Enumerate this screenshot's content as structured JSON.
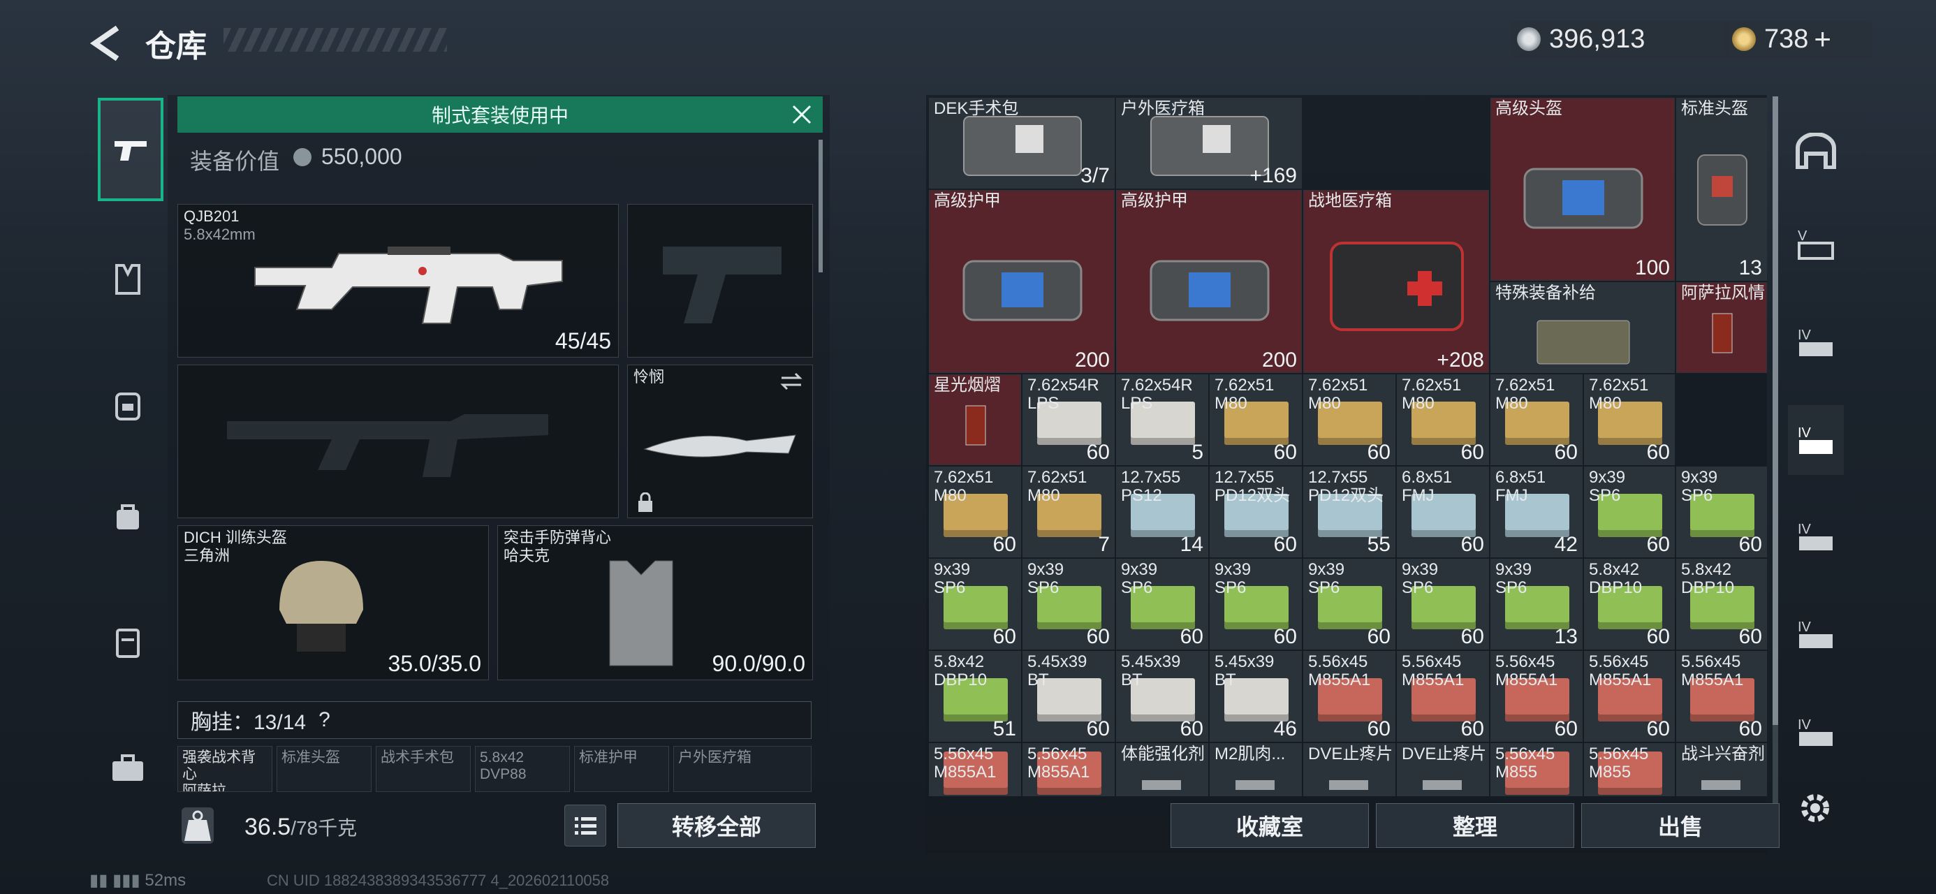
{
  "header": {
    "title": "仓库",
    "currency_silver": "396,913",
    "currency_gold": "738",
    "add_symbol": "+"
  },
  "loadout": {
    "banner": "制式套装使用中",
    "equip_value_label": "装备价值",
    "equip_value": "550,000",
    "primary": {
      "name": "QJB201",
      "caliber": "5.8x42mm",
      "ammo": "45/45"
    },
    "melee": {
      "name": "怜悯"
    },
    "helmet": {
      "name": "DICH 训练头盔",
      "map": "三角洲",
      "durability": "35.0/35.0"
    },
    "armor": {
      "name": "突击手防弹背心",
      "map": "哈夫克",
      "durability": "90.0/90.0"
    },
    "chest_label": "胸挂：13/14",
    "chest_help": "?",
    "chest_sub": [
      {
        "l1": "强袭战术背心",
        "l2": "阿萨拉"
      },
      {
        "l1": "标准头盔",
        "l2": ""
      },
      {
        "l1": "战术手术包",
        "l2": ""
      },
      {
        "l1": "5.8x42",
        "l2": "DVP88"
      },
      {
        "l1": "标准护甲",
        "l2": ""
      },
      {
        "l1": "户外医疗箱",
        "l2": ""
      }
    ],
    "weight": "36.5",
    "weight_max": "/78千克",
    "transfer_all": "转移全部"
  },
  "storage": {
    "items": [
      {
        "n": "DEK手术包",
        "c": "3/7"
      },
      {
        "n": "户外医疗箱",
        "c": "+169"
      },
      {
        "n": "高级头盔",
        "c": "100"
      },
      {
        "n": "标准头盔",
        "c": "13"
      },
      {
        "n": "高级护甲",
        "c": "200"
      },
      {
        "n": "高级护甲",
        "c": "200"
      },
      {
        "n": "战地医疗箱",
        "c": "+208"
      },
      {
        "n": "特殊装备补给",
        "c": ""
      },
      {
        "n": "阿萨拉风情",
        "c": ""
      },
      {
        "n": "星光烟熠",
        "c": ""
      },
      {
        "n": "7.62x54R\nLPS",
        "c": "60"
      },
      {
        "n": "7.62x54R\nLPS",
        "c": "5"
      },
      {
        "n": "7.62x51\nM80",
        "c": "60"
      },
      {
        "n": "7.62x51\nM80",
        "c": "60"
      },
      {
        "n": "7.62x51\nM80",
        "c": "60"
      },
      {
        "n": "7.62x51\nM80",
        "c": "60"
      },
      {
        "n": "7.62x51\nM80",
        "c": "60"
      },
      {
        "n": "7.62x51\nM80",
        "c": "60"
      },
      {
        "n": "7.62x51\nM80",
        "c": "7"
      },
      {
        "n": "12.7x55\nPS12",
        "c": "14"
      },
      {
        "n": "12.7x55\nPD12双头",
        "c": "60"
      },
      {
        "n": "12.7x55\nPD12双头",
        "c": "55"
      },
      {
        "n": "6.8x51\nFMJ",
        "c": "60"
      },
      {
        "n": "6.8x51\nFMJ",
        "c": "42"
      },
      {
        "n": "9x39\nSP6",
        "c": "60"
      },
      {
        "n": "9x39\nSP6",
        "c": "60"
      },
      {
        "n": "9x39\nSP6",
        "c": "60"
      },
      {
        "n": "9x39\nSP6",
        "c": "60"
      },
      {
        "n": "9x39\nSP6",
        "c": "60"
      },
      {
        "n": "9x39\nSP6",
        "c": "60"
      },
      {
        "n": "9x39\nSP6",
        "c": "60"
      },
      {
        "n": "9x39\nSP6",
        "c": "60"
      },
      {
        "n": "9x39\nSP6",
        "c": "13"
      },
      {
        "n": "5.8x42\nDBP10",
        "c": "60"
      },
      {
        "n": "5.8x42\nDBP10",
        "c": "60"
      },
      {
        "n": "5.8x42\nDBP10",
        "c": "51"
      },
      {
        "n": "5.45x39\nBT",
        "c": "60"
      },
      {
        "n": "5.45x39\nBT",
        "c": "60"
      },
      {
        "n": "5.45x39\nBT",
        "c": "46"
      },
      {
        "n": "5.56x45\nM855A1",
        "c": "60"
      },
      {
        "n": "5.56x45\nM855A1",
        "c": "60"
      },
      {
        "n": "5.56x45\nM855A1",
        "c": "60"
      },
      {
        "n": "5.56x45\nM855A1",
        "c": "60"
      },
      {
        "n": "5.56x45\nM855A1",
        "c": "60"
      },
      {
        "n": "5.56x45\nM855A1",
        "c": ""
      },
      {
        "n": "5.56x45\nM855A1",
        "c": ""
      },
      {
        "n": "体能强化剂",
        "c": ""
      },
      {
        "n": "M2肌肉...",
        "c": ""
      },
      {
        "n": "DVE止疼片",
        "c": ""
      },
      {
        "n": "DVE止疼片",
        "c": ""
      },
      {
        "n": "5.56x45\nM855",
        "c": ""
      },
      {
        "n": "5.56x45\nM855",
        "c": ""
      },
      {
        "n": "战斗兴奋剂",
        "c": ""
      }
    ],
    "collection_btn": "收藏室",
    "sort_btn": "整理",
    "sell_btn": "出售"
  },
  "status": {
    "ping": "52ms",
    "uid": "CN UID 1882438389343536777 4_202602110058"
  },
  "colors": {
    "accent_green": "#17795a",
    "rare_red": "#62262c",
    "panel_dark": "#161b21"
  }
}
